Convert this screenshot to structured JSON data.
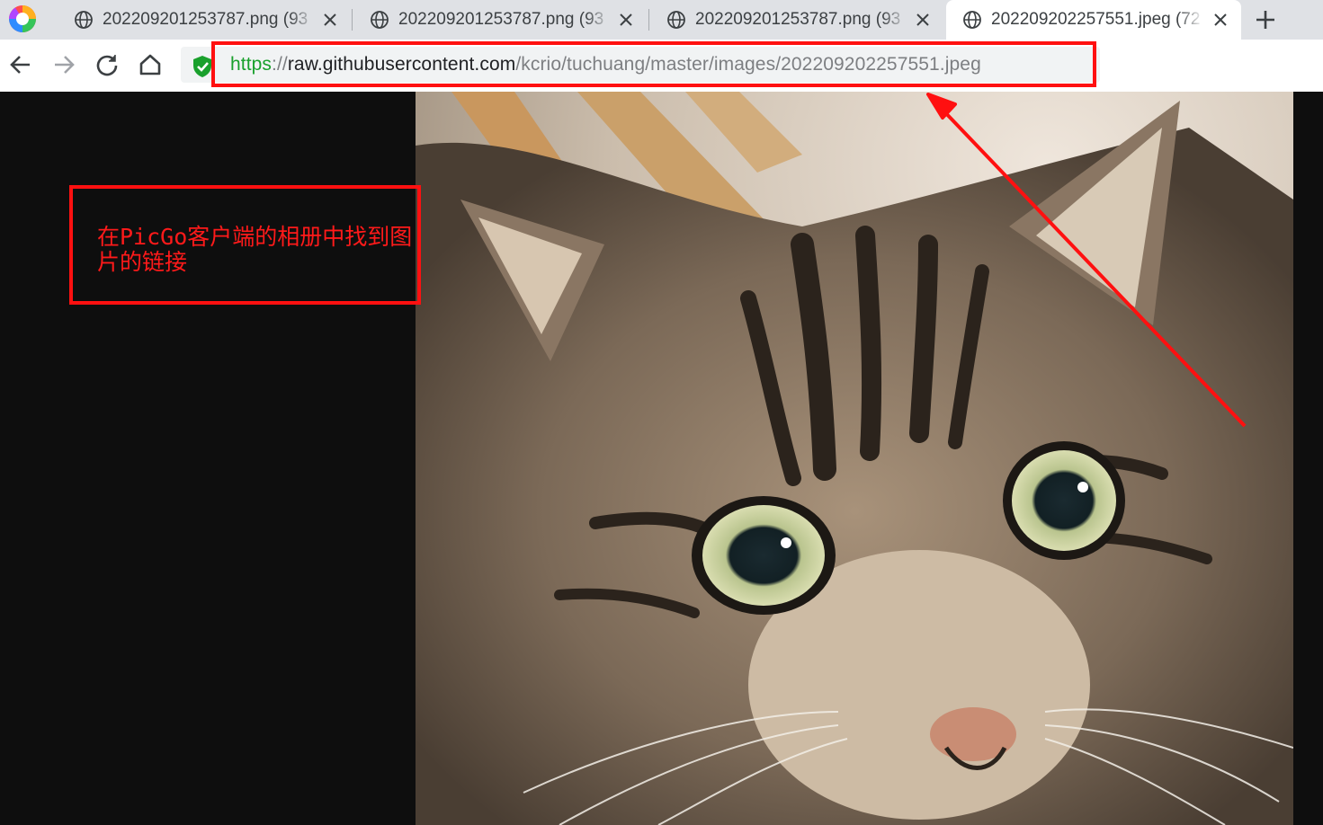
{
  "tabs": [
    {
      "title": "202209201253787.png (93",
      "active": false
    },
    {
      "title": "202209201253787.png (93",
      "active": false
    },
    {
      "title": "202209201253787.png (93",
      "active": false
    },
    {
      "title": "202209202257551.jpeg (72",
      "active": true
    }
  ],
  "url": {
    "scheme": "https",
    "separator": "://",
    "host": "raw.githubusercontent.com",
    "path": "/kcrio/tuchuang/master/images/202209202257551.jpeg"
  },
  "annotation": {
    "note": "在PicGo客户端的相册中找到图片的链接",
    "color": "#ff1010"
  },
  "colors": {
    "tab_strip": "#dfe1e5",
    "omnibox": "#f1f3f4",
    "secure_green": "#19a02c",
    "page_background": "#0e0e0e"
  }
}
